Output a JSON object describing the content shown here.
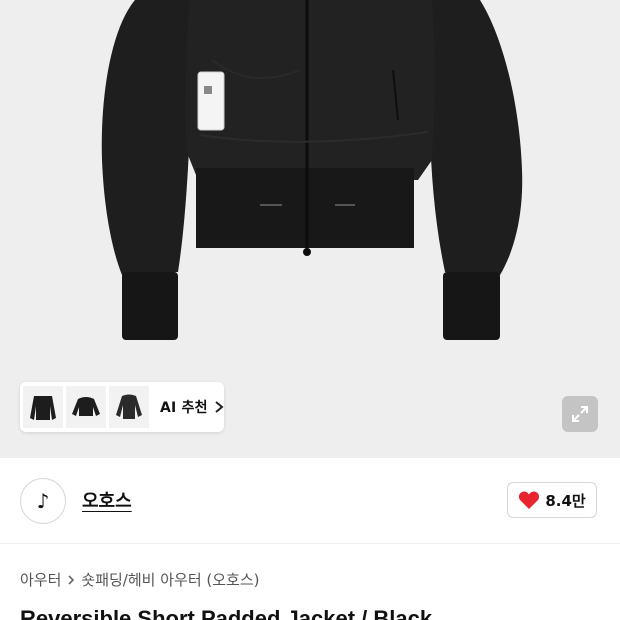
{
  "product_image": {
    "alt": "jacket-photo"
  },
  "ai_recommend": {
    "label": "AI 추천",
    "thumbnails": [
      "thumb-jacket-1",
      "thumb-jacket-2",
      "thumb-jacket-3"
    ]
  },
  "brand": {
    "logo_glyph": "♪",
    "name": "오호스"
  },
  "like": {
    "count": "8.4만",
    "heart_color": "#e8242f"
  },
  "breadcrumb": {
    "items": [
      "아우터",
      "숏패딩/헤비 아우터 (오호스)"
    ]
  },
  "product": {
    "title": "Reversible Short Padded Jacket / Black"
  }
}
